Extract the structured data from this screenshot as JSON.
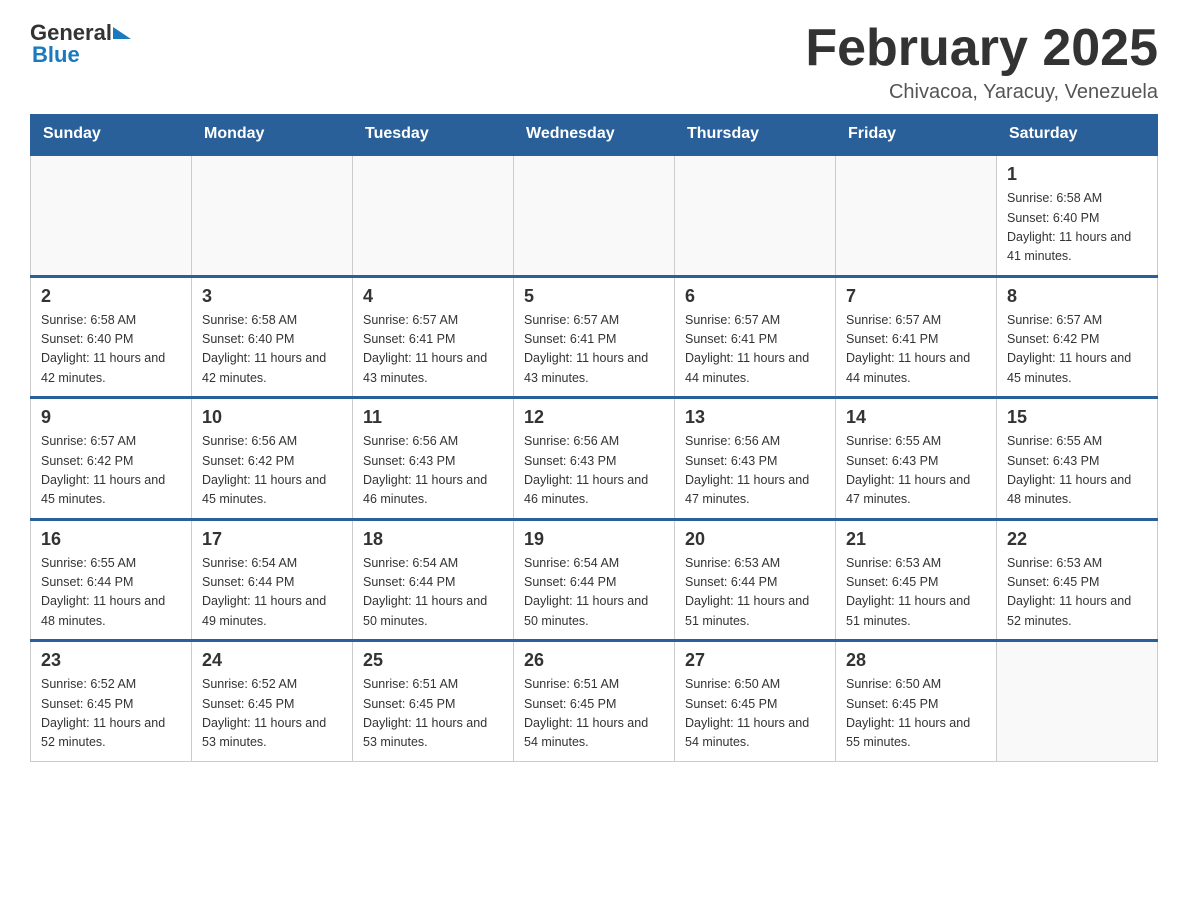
{
  "header": {
    "logo": {
      "general_text": "General",
      "blue_text": "Blue"
    },
    "title": "February 2025",
    "location": "Chivacoa, Yaracuy, Venezuela"
  },
  "calendar": {
    "days_of_week": [
      "Sunday",
      "Monday",
      "Tuesday",
      "Wednesday",
      "Thursday",
      "Friday",
      "Saturday"
    ],
    "weeks": [
      [
        {
          "day": "",
          "details": ""
        },
        {
          "day": "",
          "details": ""
        },
        {
          "day": "",
          "details": ""
        },
        {
          "day": "",
          "details": ""
        },
        {
          "day": "",
          "details": ""
        },
        {
          "day": "",
          "details": ""
        },
        {
          "day": "1",
          "details": "Sunrise: 6:58 AM\nSunset: 6:40 PM\nDaylight: 11 hours and 41 minutes."
        }
      ],
      [
        {
          "day": "2",
          "details": "Sunrise: 6:58 AM\nSunset: 6:40 PM\nDaylight: 11 hours and 42 minutes."
        },
        {
          "day": "3",
          "details": "Sunrise: 6:58 AM\nSunset: 6:40 PM\nDaylight: 11 hours and 42 minutes."
        },
        {
          "day": "4",
          "details": "Sunrise: 6:57 AM\nSunset: 6:41 PM\nDaylight: 11 hours and 43 minutes."
        },
        {
          "day": "5",
          "details": "Sunrise: 6:57 AM\nSunset: 6:41 PM\nDaylight: 11 hours and 43 minutes."
        },
        {
          "day": "6",
          "details": "Sunrise: 6:57 AM\nSunset: 6:41 PM\nDaylight: 11 hours and 44 minutes."
        },
        {
          "day": "7",
          "details": "Sunrise: 6:57 AM\nSunset: 6:41 PM\nDaylight: 11 hours and 44 minutes."
        },
        {
          "day": "8",
          "details": "Sunrise: 6:57 AM\nSunset: 6:42 PM\nDaylight: 11 hours and 45 minutes."
        }
      ],
      [
        {
          "day": "9",
          "details": "Sunrise: 6:57 AM\nSunset: 6:42 PM\nDaylight: 11 hours and 45 minutes."
        },
        {
          "day": "10",
          "details": "Sunrise: 6:56 AM\nSunset: 6:42 PM\nDaylight: 11 hours and 45 minutes."
        },
        {
          "day": "11",
          "details": "Sunrise: 6:56 AM\nSunset: 6:43 PM\nDaylight: 11 hours and 46 minutes."
        },
        {
          "day": "12",
          "details": "Sunrise: 6:56 AM\nSunset: 6:43 PM\nDaylight: 11 hours and 46 minutes."
        },
        {
          "day": "13",
          "details": "Sunrise: 6:56 AM\nSunset: 6:43 PM\nDaylight: 11 hours and 47 minutes."
        },
        {
          "day": "14",
          "details": "Sunrise: 6:55 AM\nSunset: 6:43 PM\nDaylight: 11 hours and 47 minutes."
        },
        {
          "day": "15",
          "details": "Sunrise: 6:55 AM\nSunset: 6:43 PM\nDaylight: 11 hours and 48 minutes."
        }
      ],
      [
        {
          "day": "16",
          "details": "Sunrise: 6:55 AM\nSunset: 6:44 PM\nDaylight: 11 hours and 48 minutes."
        },
        {
          "day": "17",
          "details": "Sunrise: 6:54 AM\nSunset: 6:44 PM\nDaylight: 11 hours and 49 minutes."
        },
        {
          "day": "18",
          "details": "Sunrise: 6:54 AM\nSunset: 6:44 PM\nDaylight: 11 hours and 50 minutes."
        },
        {
          "day": "19",
          "details": "Sunrise: 6:54 AM\nSunset: 6:44 PM\nDaylight: 11 hours and 50 minutes."
        },
        {
          "day": "20",
          "details": "Sunrise: 6:53 AM\nSunset: 6:44 PM\nDaylight: 11 hours and 51 minutes."
        },
        {
          "day": "21",
          "details": "Sunrise: 6:53 AM\nSunset: 6:45 PM\nDaylight: 11 hours and 51 minutes."
        },
        {
          "day": "22",
          "details": "Sunrise: 6:53 AM\nSunset: 6:45 PM\nDaylight: 11 hours and 52 minutes."
        }
      ],
      [
        {
          "day": "23",
          "details": "Sunrise: 6:52 AM\nSunset: 6:45 PM\nDaylight: 11 hours and 52 minutes."
        },
        {
          "day": "24",
          "details": "Sunrise: 6:52 AM\nSunset: 6:45 PM\nDaylight: 11 hours and 53 minutes."
        },
        {
          "day": "25",
          "details": "Sunrise: 6:51 AM\nSunset: 6:45 PM\nDaylight: 11 hours and 53 minutes."
        },
        {
          "day": "26",
          "details": "Sunrise: 6:51 AM\nSunset: 6:45 PM\nDaylight: 11 hours and 54 minutes."
        },
        {
          "day": "27",
          "details": "Sunrise: 6:50 AM\nSunset: 6:45 PM\nDaylight: 11 hours and 54 minutes."
        },
        {
          "day": "28",
          "details": "Sunrise: 6:50 AM\nSunset: 6:45 PM\nDaylight: 11 hours and 55 minutes."
        },
        {
          "day": "",
          "details": ""
        }
      ]
    ]
  }
}
